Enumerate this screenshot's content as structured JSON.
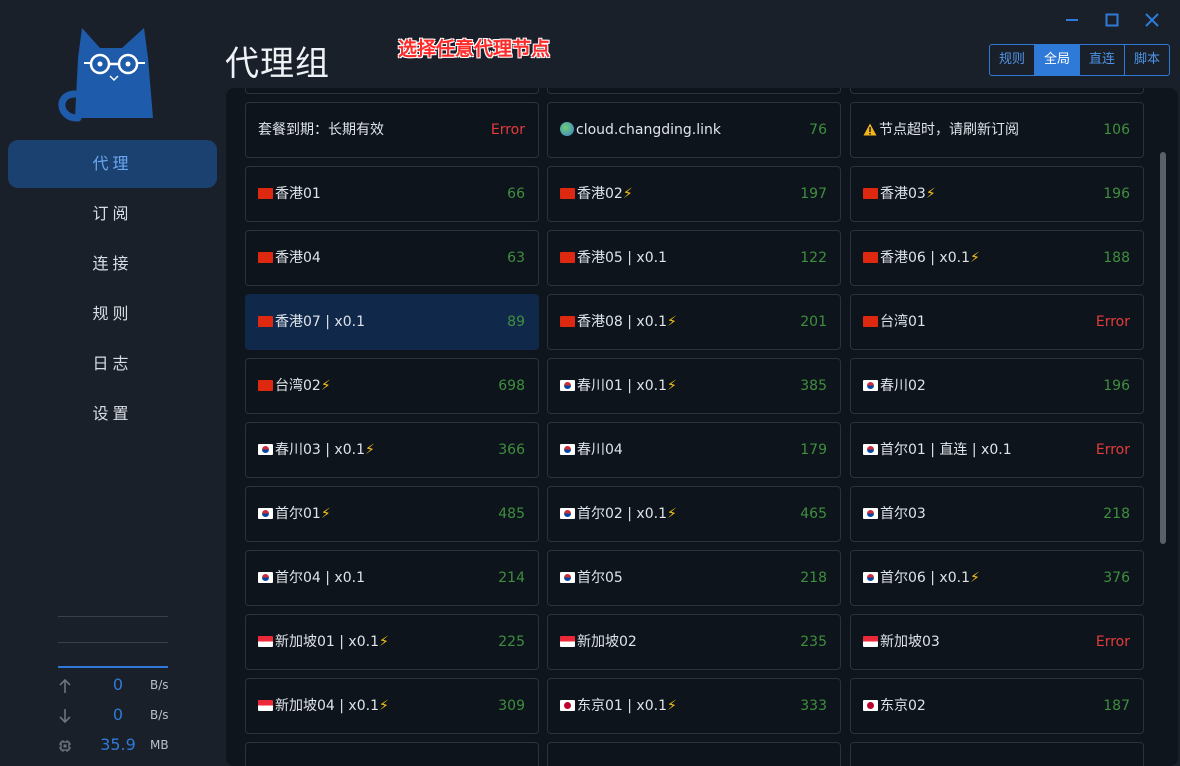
{
  "app": {
    "page_title": "代理组",
    "annotation": "选择任意代理节点",
    "accent_color": "#2f7ad8",
    "error_color": "#e43b3b",
    "ok_color": "#3e8f3e"
  },
  "window_controls": {
    "minimize_icon": "minimize-icon",
    "maximize_icon": "maximize-icon",
    "close_icon": "close-icon"
  },
  "sidebar": {
    "logo_icon": "cat-logo-icon",
    "items": [
      {
        "label": "代理",
        "active": true
      },
      {
        "label": "订阅"
      },
      {
        "label": "连接"
      },
      {
        "label": "规则"
      },
      {
        "label": "日志"
      },
      {
        "label": "设置"
      }
    ],
    "traffic": {
      "upload": {
        "value": "0",
        "unit": "B/s",
        "icon": "arrow-up-icon"
      },
      "download": {
        "value": "0",
        "unit": "B/s",
        "icon": "arrow-down-icon"
      },
      "memory": {
        "value": "35.9",
        "unit": "MB",
        "icon": "chip-icon"
      }
    }
  },
  "mode_tabs": [
    {
      "label": "规则"
    },
    {
      "label": "全局",
      "active": true
    },
    {
      "label": "直连"
    },
    {
      "label": "脚本"
    }
  ],
  "proxies": [
    {
      "name": "套餐到期：长期有效",
      "delay": "Error",
      "error": true,
      "flag": "",
      "bolt": false
    },
    {
      "name": "cloud.changding.link",
      "delay": "76",
      "flag": "globe",
      "bolt": false
    },
    {
      "name": "节点超时，请刷新订阅",
      "delay": "106",
      "flag": "warn",
      "bolt": false
    },
    {
      "name": "香港01",
      "delay": "66",
      "flag": "hk",
      "bolt": false
    },
    {
      "name": "香港02",
      "delay": "197",
      "flag": "hk",
      "bolt": true
    },
    {
      "name": "香港03",
      "delay": "196",
      "flag": "hk",
      "bolt": true
    },
    {
      "name": "香港04",
      "delay": "63",
      "flag": "hk",
      "bolt": false
    },
    {
      "name": "香港05 | x0.1",
      "delay": "122",
      "flag": "hk",
      "bolt": false
    },
    {
      "name": "香港06 | x0.1",
      "delay": "188",
      "flag": "hk",
      "bolt": true
    },
    {
      "name": "香港07 | x0.1",
      "delay": "89",
      "flag": "hk",
      "bolt": false,
      "selected": true
    },
    {
      "name": "香港08 | x0.1",
      "delay": "201",
      "flag": "hk",
      "bolt": true
    },
    {
      "name": "台湾01",
      "delay": "Error",
      "error": true,
      "flag": "cn",
      "bolt": false
    },
    {
      "name": "台湾02",
      "delay": "698",
      "flag": "cn",
      "bolt": true
    },
    {
      "name": "春川01 | x0.1",
      "delay": "385",
      "flag": "kr",
      "bolt": true
    },
    {
      "name": "春川02",
      "delay": "196",
      "flag": "kr",
      "bolt": false
    },
    {
      "name": "春川03 | x0.1",
      "delay": "366",
      "flag": "kr",
      "bolt": true
    },
    {
      "name": "春川04",
      "delay": "179",
      "flag": "kr",
      "bolt": false
    },
    {
      "name": "首尔01 | 直连 | x0.1",
      "delay": "Error",
      "error": true,
      "flag": "kr",
      "bolt": false
    },
    {
      "name": "首尔01",
      "delay": "485",
      "flag": "kr",
      "bolt": true
    },
    {
      "name": "首尔02 | x0.1",
      "delay": "465",
      "flag": "kr",
      "bolt": true
    },
    {
      "name": "首尔03",
      "delay": "218",
      "flag": "kr",
      "bolt": false
    },
    {
      "name": "首尔04 | x0.1",
      "delay": "214",
      "flag": "kr",
      "bolt": false
    },
    {
      "name": "首尔05",
      "delay": "218",
      "flag": "kr",
      "bolt": false
    },
    {
      "name": "首尔06 | x0.1",
      "delay": "376",
      "flag": "kr",
      "bolt": true
    },
    {
      "name": "新加坡01 | x0.1",
      "delay": "225",
      "flag": "sg",
      "bolt": true
    },
    {
      "name": "新加坡02",
      "delay": "235",
      "flag": "sg",
      "bolt": false
    },
    {
      "name": "新加坡03",
      "delay": "Error",
      "error": true,
      "flag": "sg",
      "bolt": false
    },
    {
      "name": "新加坡04 | x0.1",
      "delay": "309",
      "flag": "sg",
      "bolt": true
    },
    {
      "name": "东京01 | x0.1",
      "delay": "333",
      "flag": "jp",
      "bolt": true
    },
    {
      "name": "东京02",
      "delay": "187",
      "flag": "jp",
      "bolt": false
    }
  ]
}
